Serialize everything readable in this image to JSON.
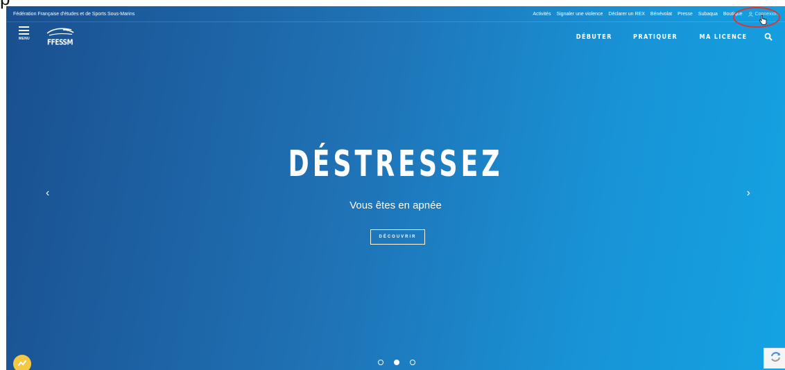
{
  "topbar": {
    "federation_name": "Fédération Française d'études et de Sports Sous-Marins",
    "links": [
      "Activités",
      "Signaler une violence",
      "Déclarer un REX",
      "Bénévolat",
      "Presse",
      "Subaqua",
      "Boutique"
    ],
    "connect_label": "Connexion"
  },
  "nav": {
    "menu_label": "MENU",
    "logo_text": "FFESSM",
    "items": [
      "DÉBUTER",
      "PRATIQUER",
      "MA LICENCE"
    ]
  },
  "hero": {
    "title": "DÉSTRESSEZ",
    "subtitle": "Vous êtes en apnée",
    "button_label": "DÉCOUVRIR",
    "prev_arrow": "‹",
    "next_arrow": "›",
    "slide_count": 3,
    "active_slide": 2
  },
  "overlay": {
    "partial_letter": "p"
  },
  "colors": {
    "gradient_start": "#1a4f8f",
    "gradient_end": "#14a3e3",
    "highlight_circle": "#e1342f",
    "badge": "#f5c842"
  }
}
